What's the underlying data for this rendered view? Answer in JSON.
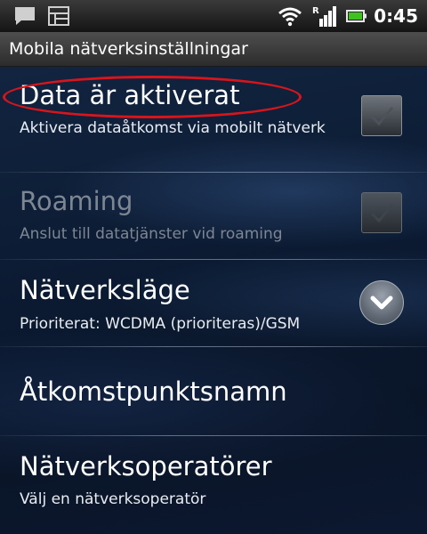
{
  "status_bar": {
    "time": "0:45",
    "icons": [
      "chat-icon",
      "gallery-icon",
      "wifi-icon",
      "signal-roaming-icon",
      "battery-icon"
    ],
    "roaming_label": "R"
  },
  "title_bar": {
    "title": "Mobila nätverksinställningar"
  },
  "settings": [
    {
      "title": "Data är aktiverat",
      "summary": "Aktivera dataåtkomst via mobilt nätverk",
      "widget": "checkbox",
      "checked": true,
      "enabled": true
    },
    {
      "title": "Roaming",
      "summary": "Anslut till datatjänster vid roaming",
      "widget": "checkbox",
      "checked": true,
      "enabled": false
    },
    {
      "title": "Nätverksläge",
      "summary": "Prioriterat: WCDMA (prioriteras)/GSM",
      "widget": "chevron-down-icon",
      "enabled": true
    },
    {
      "title": "Åtkomstpunktsnamn",
      "summary": "",
      "widget": "",
      "enabled": true
    },
    {
      "title": "Nätverksoperatörer",
      "summary": "Välj en nätverksoperatör",
      "widget": "",
      "enabled": true
    }
  ],
  "colors": {
    "highlight": "#d8151c",
    "background": "#0c1626",
    "disabled_text": "#7d8693"
  }
}
